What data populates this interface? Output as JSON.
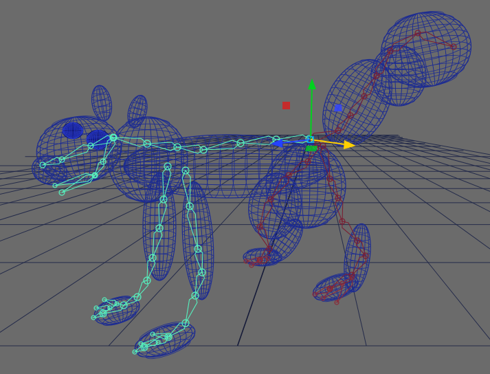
{
  "viewport": {
    "colors": {
      "background": "#6b6b6b",
      "grid": "#1d2547",
      "grid_axis": "#0c1233",
      "mesh": "#1d2c92",
      "mesh_dark": "#0f1a6a",
      "eye": "#0a1484",
      "front_skeleton": "#56f0be",
      "front_skeleton_light": "#a6ffe4",
      "rear_skeleton": "#7a1f33",
      "rear_joint": "#8a2b3a",
      "gizmo_y": "#00d21e",
      "gizmo_x": "#ffd000",
      "gizmo_z": "#2442ff",
      "gizmo_plane_red": "#d32020",
      "gizmo_plane_blue": "#3345ff",
      "gizmo_center": "#00b0ff"
    },
    "icons": [
      "move-manipulator-icon",
      "plane-handle-icon"
    ]
  }
}
